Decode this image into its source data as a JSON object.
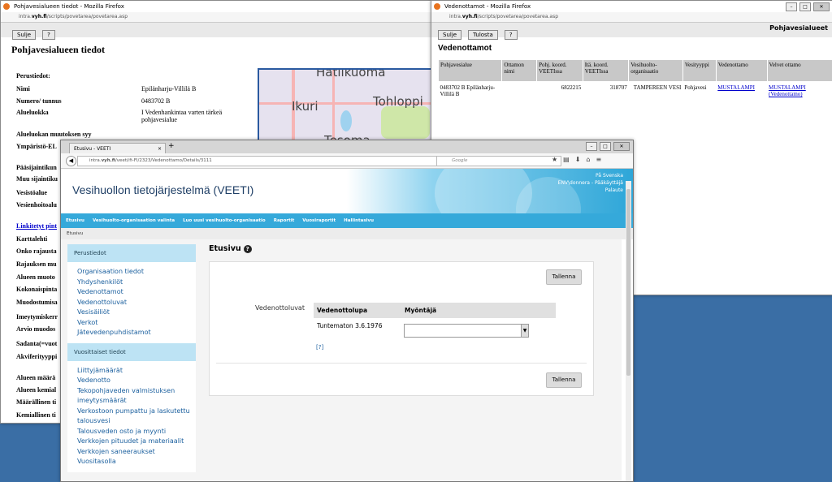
{
  "win1": {
    "title": "Pohjavesialueen tiedot - Mozilla Firefox",
    "url_prefix": "intra.",
    "url_host": "vyh.fi",
    "url_path": "/scripts/povetarea/povetarea.asp",
    "btn_close": "Sulje",
    "btn_help": "?",
    "heading": "Pohjavesialueen tiedot",
    "rows": [
      {
        "k": "Perustiedot:",
        "v": ""
      },
      {
        "k": "Nimi",
        "v": "Epilänharju-Villilä B"
      },
      {
        "k": "Numero/ tunnus",
        "v": "0483702 B"
      },
      {
        "k": "Alueluokka",
        "v": "I Vedenhankintaa varten tärkeä pohjavesialue"
      },
      {
        "k": "Alueluokan muutoksen syy",
        "v": ""
      },
      {
        "k": "Ympäristö-EL",
        "v": ""
      },
      {
        "k": "Pääsijaintikun",
        "v": ""
      },
      {
        "k": "Muu sijaintiku",
        "v": ""
      },
      {
        "k": "Vesistöalue",
        "v": ""
      },
      {
        "k": "Vesienhoitoalu",
        "v": ""
      },
      {
        "k": "Linkitetyt pint",
        "v": ""
      },
      {
        "k": "Karttalehti",
        "v": ""
      },
      {
        "k": "Onko rajausta",
        "v": ""
      },
      {
        "k": "Rajauksen mu",
        "v": ""
      },
      {
        "k": "Alueen muoto",
        "v": ""
      },
      {
        "k": "Kokonaispinta",
        "v": ""
      },
      {
        "k": "Muodostumisa",
        "v": ""
      },
      {
        "k": "Imeytymiskerr",
        "v": ""
      },
      {
        "k": "Arvio muodos",
        "v": ""
      },
      {
        "k": "Sadanta(=vuot",
        "v": ""
      },
      {
        "k": "Akviferityyppi",
        "v": ""
      },
      {
        "k": "Alueen määrä",
        "v": ""
      },
      {
        "k": "Alueen kemial",
        "v": ""
      },
      {
        "k": "Määrällinen ti",
        "v": ""
      },
      {
        "k": "Kemiallinen ti",
        "v": ""
      }
    ],
    "map_labels": [
      "Hatiikuoma",
      "Ikuri",
      "Tohloppi",
      "Tesoma"
    ]
  },
  "win2": {
    "title": "Vedenottamot - Mozilla Firefox",
    "url_prefix": "intra.",
    "url_host": "vyh.fi",
    "url_path": "/scripts/povetarea/povetarea.asp",
    "btn_close": "Sulje",
    "btn_print": "Tulosta",
    "btn_help": "?",
    "right_title": "Pohjavesialueet",
    "heading": "Vedenottamot",
    "columns": [
      "Pohjavesialue",
      "Ottamon nimi",
      "Pohj. koord. VEETIssa",
      "Itä. koord. VEETIssa",
      "Vesihuolto-organisaatio",
      "Vesityyppi",
      "Vedenottamo",
      "Velvet ottamo"
    ],
    "row": {
      "area": "0483702 B Epilänharju-Villilä B",
      "name": "",
      "north": "6822215",
      "east": "318707",
      "org": "TAMPEREEN VESI",
      "type": "Pohjavesi",
      "intake": "MUSTALAMPI",
      "intake2": "MUSTALAMPI (Vedenottamo)"
    }
  },
  "win3": {
    "tab_title": "Etusivu - VEETI",
    "url_prefix": "intra.",
    "url_host": "vyh.fi",
    "url_path": "/veeti/fi-FI/2323/Vedenottamo/Details/3111",
    "search_placeholder": "Google",
    "site_title": "Vesihuollon tietojärjestelmä (VEETI)",
    "util_links": [
      "På Svenska",
      "ENV\\donnera - Pääkäyttäjä",
      "Palaute"
    ],
    "menu": [
      "Etusivu",
      "Vesihuolto-organisaation valinta",
      "Luo uusi vesihuolto-organisaatio",
      "Raportit",
      "Vuosiraportit",
      "Hallintasivu"
    ],
    "breadcrumb": "Etusivu",
    "sidebar": {
      "head1": "Perustiedot",
      "items1": [
        "Organisaation tiedot",
        "Yhdyshenkilöt",
        "Vedenottamot",
        "Vedenottoluvat",
        "Vesisäiliöt",
        "Verkot",
        "Jätevedenpuhdistamot"
      ],
      "head2": "Vuosittaiset tiedot",
      "items2": [
        "Liittyjämäärät",
        "Vedenotto",
        "Tekopohjaveden valmistuksen imeytysmäärät",
        "Verkostoon pumpattu ja laskutettu talousvesi",
        "Talousveden osto ja myynti",
        "Verkkojen pituudet ja materiaalit",
        "Verkkojen saneeraukset",
        "Vuositasolla"
      ]
    },
    "page_heading": "Etusivu",
    "save": "Tallenna",
    "permits_label": "Vedenottoluvat",
    "col1": "Vedenottolupa",
    "col2": "Myöntäjä",
    "permit": "Tuntematon 3.6.1976",
    "help_link": "[?]"
  }
}
